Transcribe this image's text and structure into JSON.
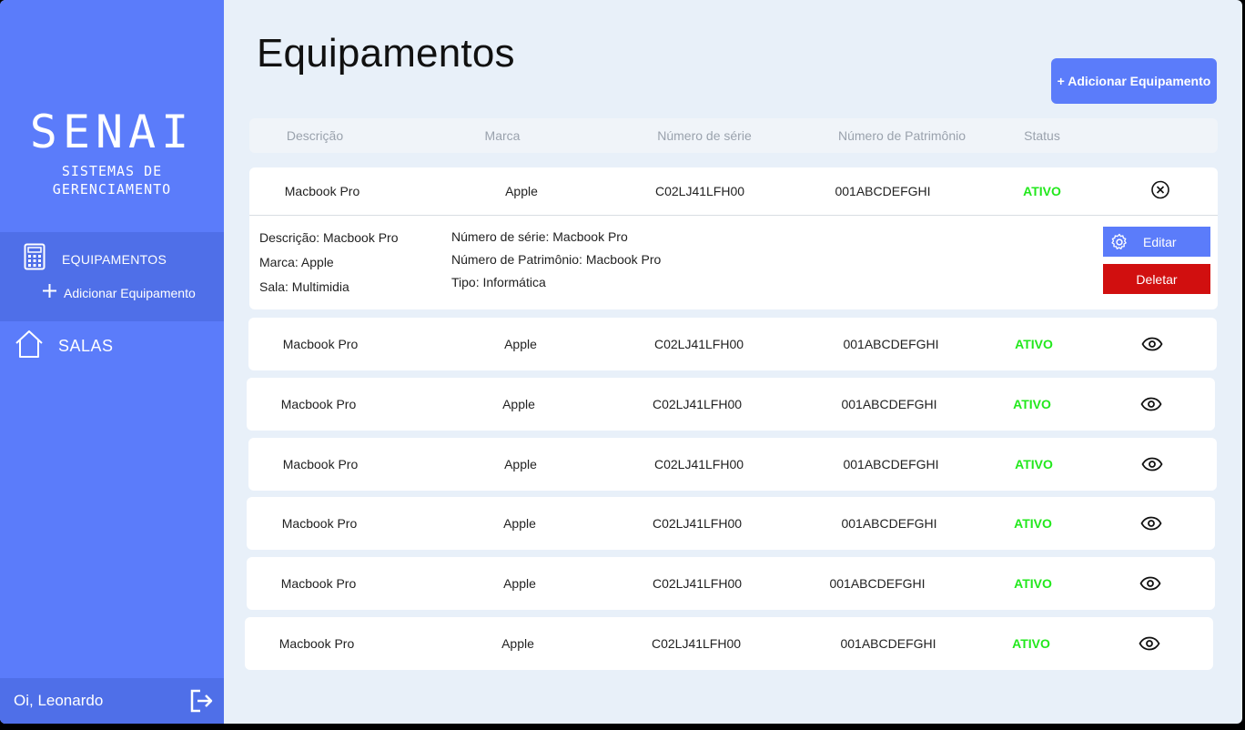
{
  "sidebar": {
    "brand_title": "SENAI",
    "brand_sub1": "SISTEMAS DE",
    "brand_sub2": "GERENCIAMENTO",
    "nav": {
      "equipamentos": "EQUIPAMENTOS",
      "adicionar": "Adicionar Equipamento",
      "salas": "SALAS"
    },
    "greeting": "Oi, Leonardo"
  },
  "header": {
    "title": "Equipamentos",
    "add_button": "+ Adicionar Equipamento"
  },
  "table": {
    "columns": [
      "Descrição",
      "Marca",
      "Número de série",
      "Número de Patrimônio",
      "Status"
    ],
    "expanded_row": {
      "descricao": "Macbook Pro",
      "marca": "Apple",
      "serie": "C02LJ41LFH00",
      "patrimonio": "001ABCDEFGHI",
      "status": "ATIVO",
      "details": {
        "descricao": "Descrição: Macbook Pro",
        "marca": "Marca: Apple",
        "sala": "Sala: Multimidia",
        "serie": "Número de série: Macbook Pro",
        "patrimonio": "Número de Patrimônio: Macbook Pro",
        "tipo": "Tipo: Informática"
      },
      "edit_label": "Editar",
      "delete_label": "Deletar"
    },
    "rows": [
      {
        "descricao": "Macbook Pro",
        "marca": "Apple",
        "serie": "C02LJ41LFH00",
        "patrimonio": "001ABCDEFGHI",
        "status": "ATIVO"
      },
      {
        "descricao": "Macbook Pro",
        "marca": "Apple",
        "serie": "C02LJ41LFH00",
        "patrimonio": "001ABCDEFGHI",
        "status": "ATIVO"
      },
      {
        "descricao": "Macbook Pro",
        "marca": "Apple",
        "serie": "C02LJ41LFH00",
        "patrimonio": "001ABCDEFGHI",
        "status": "ATIVO"
      },
      {
        "descricao": "Macbook Pro",
        "marca": "Apple",
        "serie": "C02LJ41LFH00",
        "patrimonio": "001ABCDEFGHI",
        "status": "ATIVO"
      },
      {
        "descricao": "Macbook Pro",
        "marca": "Apple",
        "serie": "C02LJ41LFH00",
        "patrimonio": "001ABCDEFGHI",
        "status": "ATIVO"
      },
      {
        "descricao": "Macbook Pro",
        "marca": "Apple",
        "serie": "C02LJ41LFH00",
        "patrimonio": "001ABCDEFGHI",
        "status": "ATIVO"
      }
    ]
  },
  "colors": {
    "primary": "#5b7cfa",
    "sidebar_active": "#4f6fe8",
    "status_active": "#22e81c",
    "danger": "#d10f0f",
    "background": "#e8f0f9"
  },
  "icons": {
    "equipamentos": "calculator-icon",
    "adicionar": "plus-icon",
    "salas": "house-icon",
    "logout": "logout-icon",
    "close": "close-circle-icon",
    "view": "eye-icon",
    "edit": "gear-icon"
  }
}
